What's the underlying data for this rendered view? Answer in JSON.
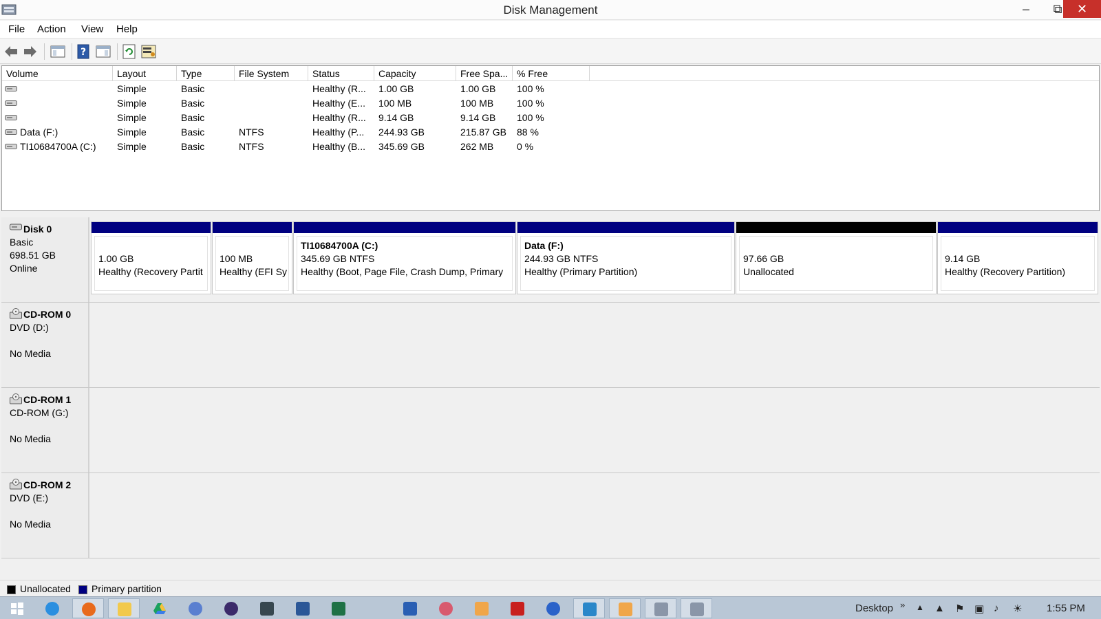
{
  "window": {
    "title": "Disk Management",
    "minimize_icon": "minimize-icon",
    "restore_icon": "restore-icon",
    "close_icon": "close-icon"
  },
  "menu": {
    "items": [
      "File",
      "Action",
      "View",
      "Help"
    ]
  },
  "toolbar": {
    "icons": [
      "back-icon",
      "forward-icon",
      "console-tree-icon",
      "help-icon",
      "properties-icon",
      "refresh-icon",
      "rescan-disks-icon"
    ]
  },
  "volume_list": {
    "columns": [
      "Volume",
      "Layout",
      "Type",
      "File System",
      "Status",
      "Capacity",
      "Free Spa...",
      "% Free"
    ],
    "rows": [
      {
        "volume": "",
        "layout": "Simple",
        "type": "Basic",
        "fs": "",
        "status": "Healthy (R...",
        "capacity": "1.00 GB",
        "free": "1.00 GB",
        "pct": "100 %"
      },
      {
        "volume": "",
        "layout": "Simple",
        "type": "Basic",
        "fs": "",
        "status": "Healthy (E...",
        "capacity": "100 MB",
        "free": "100 MB",
        "pct": "100 %"
      },
      {
        "volume": "",
        "layout": "Simple",
        "type": "Basic",
        "fs": "",
        "status": "Healthy (R...",
        "capacity": "9.14 GB",
        "free": "9.14 GB",
        "pct": "100 %"
      },
      {
        "volume": "Data (F:)",
        "layout": "Simple",
        "type": "Basic",
        "fs": "NTFS",
        "status": "Healthy (P...",
        "capacity": "244.93 GB",
        "free": "215.87 GB",
        "pct": "88 %"
      },
      {
        "volume": "TI10684700A (C:)",
        "layout": "Simple",
        "type": "Basic",
        "fs": "NTFS",
        "status": "Healthy (B...",
        "capacity": "345.69 GB",
        "free": "262 MB",
        "pct": "0 %"
      }
    ]
  },
  "disks": [
    {
      "name": "Disk 0",
      "line1": "Basic",
      "line2": "698.51 GB",
      "line3": "Online",
      "partitions": [
        {
          "name": "",
          "size": "1.00 GB",
          "status": "Healthy (Recovery Partit",
          "kind": "primary"
        },
        {
          "name": "",
          "size": "100 MB",
          "status": "Healthy (EFI Sy",
          "kind": "primary"
        },
        {
          "name": "TI10684700A  (C:)",
          "size": "345.69 GB NTFS",
          "status": "Healthy (Boot, Page File, Crash Dump, Primary",
          "kind": "primary"
        },
        {
          "name": "Data  (F:)",
          "size": "244.93 GB NTFS",
          "status": "Healthy (Primary Partition)",
          "kind": "primary"
        },
        {
          "name": "",
          "size": "97.66 GB",
          "status": "Unallocated",
          "kind": "unallocated"
        },
        {
          "name": "",
          "size": "9.14 GB",
          "status": "Healthy (Recovery Partition)",
          "kind": "primary"
        }
      ]
    },
    {
      "name": "CD-ROM 0",
      "line1": "DVD (D:)",
      "line2": "",
      "line3": "No Media"
    },
    {
      "name": "CD-ROM 1",
      "line1": "CD-ROM (G:)",
      "line2": "",
      "line3": "No Media"
    },
    {
      "name": "CD-ROM 2",
      "line1": "DVD (E:)",
      "line2": "",
      "line3": "No Media"
    }
  ],
  "legend": {
    "unallocated": "Unallocated",
    "primary": "Primary partition",
    "unallocated_color": "#000000",
    "primary_color": "#000080"
  },
  "taskbar": {
    "items": [
      "start-icon",
      "internet-explorer-icon",
      "firefox-icon",
      "file-explorer-icon",
      "google-drive-icon",
      "app-icon",
      "media-icon",
      "camera-icon",
      "word-icon",
      "excel-icon",
      "calendar-app-icon",
      "tool-icon",
      "media-player-icon",
      "acrobat-icon",
      "info-icon",
      "app-c-icon",
      "player-icon",
      "disk-management-icon",
      "disk-management-icon"
    ],
    "desktop_label": "Desktop",
    "chevron": "»",
    "time": "1:55 PM"
  }
}
